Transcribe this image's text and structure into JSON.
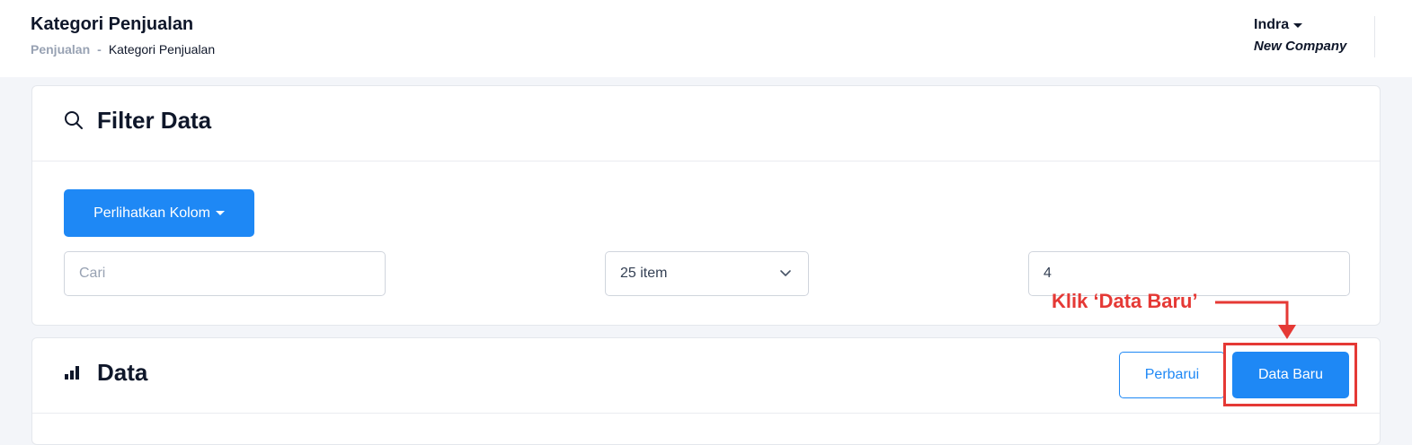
{
  "header": {
    "title": "Kategori Penjualan",
    "breadcrumb": {
      "parent": "Penjualan",
      "separator": "-",
      "current": "Kategori Penjualan"
    },
    "user": {
      "name": "Indra",
      "company": "New Company"
    }
  },
  "filter": {
    "title": "Filter Data",
    "icon": "search-icon",
    "columns_button": "Perlihatkan Kolom",
    "search_placeholder": "Cari",
    "page_size": "25 item",
    "number_value": "4"
  },
  "data_section": {
    "title": "Data",
    "icon": "bar-chart-icon",
    "refresh_button": "Perbarui",
    "new_button": "Data Baru"
  },
  "annotation": {
    "text": "Klik ‘Data Baru’",
    "color": "#e53935"
  },
  "colors": {
    "primary": "#1e88f5",
    "annotation": "#e53935"
  }
}
